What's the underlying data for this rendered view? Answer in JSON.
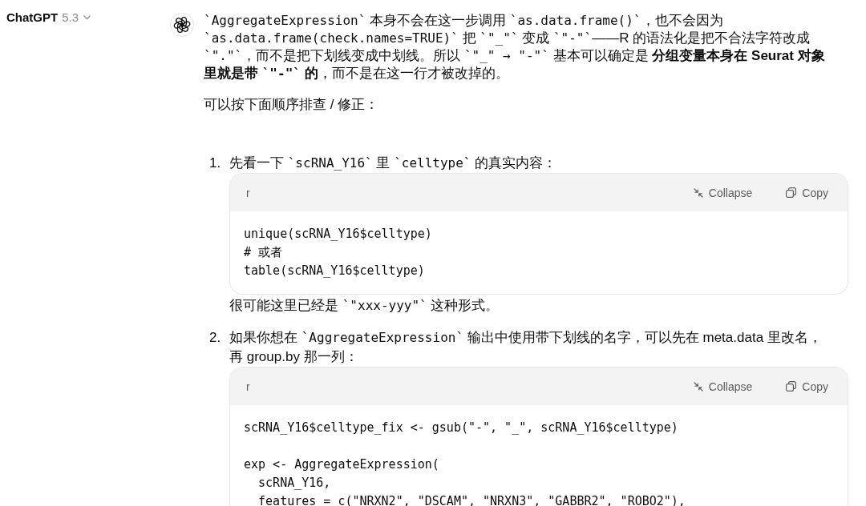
{
  "model_switcher": {
    "name": "ChatGPT",
    "version": "5.3"
  },
  "message": {
    "paragraphs": [
      {
        "runs": [
          {
            "text": "`AggregateExpression`",
            "mono": true,
            "bold": false
          },
          {
            "text": " 本身不会在这一步调用 ",
            "mono": false,
            "bold": false
          },
          {
            "text": "`as.data.frame()`",
            "mono": true,
            "bold": false
          },
          {
            "text": "，也不会因为 ",
            "mono": false,
            "bold": false
          },
          {
            "text": "`as.data.frame(check.names=TRUE)`",
            "mono": true,
            "bold": false
          },
          {
            "text": " 把 ",
            "mono": false,
            "bold": false
          },
          {
            "text": "`\"_\"`",
            "mono": true,
            "bold": false
          },
          {
            "text": " 变成 ",
            "mono": false,
            "bold": false
          },
          {
            "text": "`\"-\"`",
            "mono": true,
            "bold": false
          },
          {
            "text": "——R 的语法化是把不合法字符改成",
            "mono": false,
            "bold": false
          },
          {
            "text": "`\".\"`",
            "mono": true,
            "bold": false
          },
          {
            "text": "，而不是把下划线变成中划线。所以 ",
            "mono": false,
            "bold": false
          },
          {
            "text": "`\"_\" → \"-\"`",
            "mono": true,
            "bold": false
          },
          {
            "text": " 基本可以确定是 ",
            "mono": false,
            "bold": false
          },
          {
            "text": "分组变量本身在 Seurat 对象里就是带 ",
            "mono": false,
            "bold": true
          },
          {
            "text": "`\"-\"`",
            "mono": true,
            "bold": true
          },
          {
            "text": " 的",
            "mono": false,
            "bold": true
          },
          {
            "text": "，而不是在这一行才被改掉的。",
            "mono": false,
            "bold": false
          }
        ]
      },
      {
        "runs": [
          {
            "text": "可以按下面顺序排查 / 修正：",
            "mono": false,
            "bold": false
          }
        ]
      }
    ],
    "steps": [
      {
        "number": "1.",
        "runs": [
          {
            "text": "先看一下 ",
            "mono": false,
            "bold": false
          },
          {
            "text": "`scRNA_Y16`",
            "mono": true,
            "bold": false
          },
          {
            "text": " 里 ",
            "mono": false,
            "bold": false
          },
          {
            "text": "`celltype`",
            "mono": true,
            "bold": false
          },
          {
            "text": " 的真实内容：",
            "mono": false,
            "bold": false
          }
        ],
        "code_block": {
          "language": "r",
          "collapse_label": "Collapse",
          "copy_label": "Copy",
          "code": "unique(scRNA_Y16$celltype)\n# 或者\ntable(scRNA_Y16$celltype)"
        },
        "note_runs": [
          {
            "text": "很可能这里已经是 ",
            "mono": false,
            "bold": false
          },
          {
            "text": "`\"xxx-yyy\"`",
            "mono": true,
            "bold": false
          },
          {
            "text": " 这种形式。",
            "mono": false,
            "bold": false
          }
        ]
      },
      {
        "number": "2.",
        "runs": [
          {
            "text": "如果你想在 ",
            "mono": false,
            "bold": false
          },
          {
            "text": "`AggregateExpression`",
            "mono": true,
            "bold": false
          },
          {
            "text": " 输出中使用带下划线的名字，可以先在 meta.data 里改名，再 group.by 那一列：",
            "mono": false,
            "bold": false
          }
        ],
        "code_block": {
          "language": "r",
          "collapse_label": "Collapse",
          "copy_label": "Copy",
          "code": "scRNA_Y16$celltype_fix <- gsub(\"-\", \"_\", scRNA_Y16$celltype)\n\nexp <- AggregateExpression(\n  scRNA_Y16,\n  features = c(\"NRXN2\", \"DSCAM\", \"NRXN3\", \"GABBR2\", \"ROBO2\"),"
        }
      }
    ]
  }
}
